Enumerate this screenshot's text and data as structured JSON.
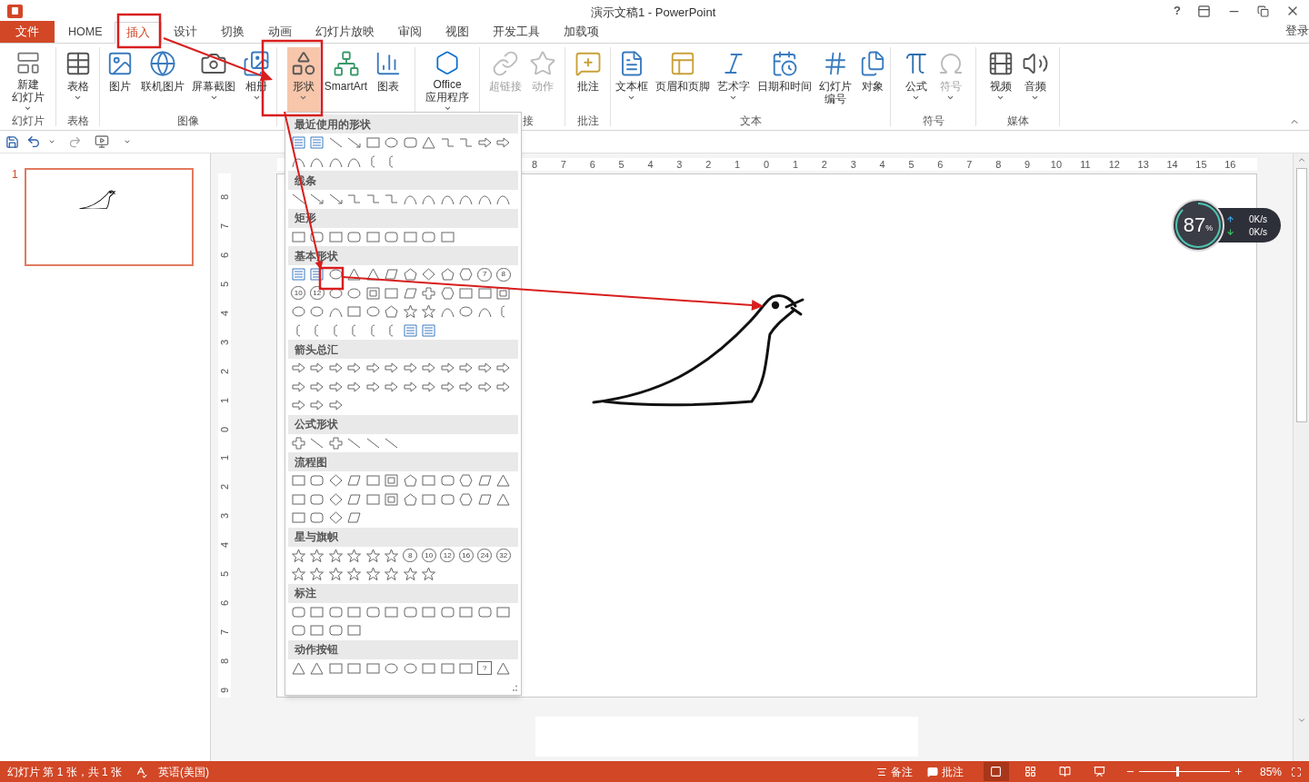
{
  "window": {
    "title": "演示文稿1 - PowerPoint",
    "help": "?",
    "account": "登录"
  },
  "tabs": [
    {
      "label": "文件",
      "kind": "file"
    },
    {
      "label": "HOME",
      "kind": "tab",
      "selected": false
    },
    {
      "label": "插入",
      "kind": "tab",
      "selected": true
    },
    {
      "label": "设计",
      "kind": "tab",
      "selected": false
    },
    {
      "label": "切换",
      "kind": "tab",
      "selected": false
    },
    {
      "label": "动画",
      "kind": "tab",
      "selected": false
    },
    {
      "label": "幻灯片放映",
      "kind": "tab",
      "selected": false
    },
    {
      "label": "审阅",
      "kind": "tab",
      "selected": false
    },
    {
      "label": "视图",
      "kind": "tab",
      "selected": false
    },
    {
      "label": "开发工具",
      "kind": "tab",
      "selected": false
    },
    {
      "label": "加载项",
      "kind": "tab",
      "selected": false
    }
  ],
  "ribbon": {
    "groups": [
      {
        "label": "幻灯片",
        "items": [
          {
            "lines": [
              "新建",
              "幻灯片"
            ],
            "dropdown": true,
            "disabled": false,
            "pressed": false
          }
        ]
      },
      {
        "label": "表格",
        "items": [
          {
            "lines": [
              "表格"
            ],
            "dropdown": true,
            "disabled": false,
            "pressed": false
          }
        ]
      },
      {
        "label": "图像",
        "items": [
          {
            "lines": [
              "图片"
            ],
            "dropdown": false,
            "disabled": false,
            "pressed": false
          },
          {
            "lines": [
              "联机图片"
            ],
            "dropdown": false,
            "disabled": false,
            "pressed": false
          },
          {
            "lines": [
              "屏幕截图"
            ],
            "dropdown": true,
            "disabled": false,
            "pressed": false
          },
          {
            "lines": [
              "相册"
            ],
            "dropdown": true,
            "disabled": false,
            "pressed": false
          }
        ]
      },
      {
        "items": [
          {
            "lines": [
              "形状"
            ],
            "dropdown": true,
            "disabled": false,
            "pressed": true
          },
          {
            "lines": [
              "SmartArt"
            ],
            "dropdown": false,
            "disabled": false,
            "pressed": false
          },
          {
            "lines": [
              "图表"
            ],
            "dropdown": false,
            "disabled": false,
            "pressed": false
          }
        ]
      },
      {
        "items": [
          {
            "lines": [
              "Office",
              "应用程序"
            ],
            "dropdown": true,
            "disabled": false,
            "pressed": false
          }
        ]
      },
      {
        "label": "接",
        "items": [
          {
            "lines": [
              "超链接"
            ],
            "dropdown": false,
            "disabled": true,
            "pressed": false
          },
          {
            "lines": [
              "动作"
            ],
            "dropdown": false,
            "disabled": true,
            "pressed": false
          }
        ]
      },
      {
        "label": "批注",
        "items": [
          {
            "lines": [
              "批注"
            ],
            "dropdown": false,
            "disabled": false,
            "pressed": false
          }
        ]
      },
      {
        "label": "文本",
        "items": [
          {
            "lines": [
              "文本框"
            ],
            "dropdown": true,
            "disabled": false,
            "pressed": false
          },
          {
            "lines": [
              "页眉和页脚"
            ],
            "dropdown": false,
            "disabled": false,
            "pressed": false
          },
          {
            "lines": [
              "艺术字"
            ],
            "dropdown": true,
            "disabled": false,
            "pressed": false
          },
          {
            "lines": [
              "日期和时间"
            ],
            "dropdown": false,
            "disabled": false,
            "pressed": false
          },
          {
            "lines": [
              "幻灯片",
              "编号"
            ],
            "dropdown": false,
            "disabled": false,
            "pressed": false
          },
          {
            "lines": [
              "对象"
            ],
            "dropdown": false,
            "disabled": false,
            "pressed": false
          }
        ]
      },
      {
        "label": "符号",
        "items": [
          {
            "lines": [
              "公式"
            ],
            "dropdown": true,
            "disabled": false,
            "pressed": false
          },
          {
            "lines": [
              "符号"
            ],
            "dropdown": true,
            "disabled": true,
            "pressed": false
          }
        ]
      },
      {
        "label": "媒体",
        "items": [
          {
            "lines": [
              "视频"
            ],
            "dropdown": true,
            "disabled": false,
            "pressed": false
          },
          {
            "lines": [
              "音频"
            ],
            "dropdown": true,
            "disabled": false,
            "pressed": false
          }
        ]
      }
    ]
  },
  "shape_menu": {
    "sections": [
      {
        "title": "最近使用的形状"
      },
      {
        "title": "线条"
      },
      {
        "title": "矩形"
      },
      {
        "title": "基本形状",
        "labels": [
          "7",
          "8",
          "10",
          "12"
        ]
      },
      {
        "title": "箭头总汇"
      },
      {
        "title": "公式形状"
      },
      {
        "title": "流程图"
      },
      {
        "title": "星与旗帜",
        "labels": [
          "8",
          "10",
          "12",
          "16",
          "24",
          "32"
        ]
      },
      {
        "title": "标注"
      },
      {
        "title": "动作按钮",
        "labels": [
          "?"
        ]
      }
    ]
  },
  "slides_panel": {
    "slides": [
      {
        "number": "1",
        "selected": true
      }
    ]
  },
  "ruler": {
    "horizontal": [
      "8",
      "7",
      "6",
      "5",
      "4",
      "3",
      "2",
      "1",
      "0",
      "1",
      "2",
      "3",
      "4",
      "5",
      "6",
      "7",
      "8",
      "9",
      "10",
      "11",
      "12",
      "13",
      "14",
      "15",
      "16"
    ],
    "vertical": [
      "8",
      "7",
      "6",
      "5",
      "4",
      "3",
      "2",
      "1",
      "0",
      "1",
      "2",
      "3",
      "4",
      "5",
      "6",
      "7",
      "8",
      "9"
    ]
  },
  "net_monitor": {
    "percent": "87",
    "unit": "%",
    "upload": "0K/s",
    "download": "0K/s"
  },
  "status_bar": {
    "slide_info": "幻灯片 第 1 张，共 1 张",
    "language": "英语(美国)",
    "notes": "备注",
    "comments": "批注",
    "views": [
      {
        "selected": true
      },
      {
        "selected": false
      },
      {
        "selected": false
      },
      {
        "selected": false
      }
    ],
    "zoom_slider": {
      "level": 0.41
    },
    "zoom": "85%"
  }
}
